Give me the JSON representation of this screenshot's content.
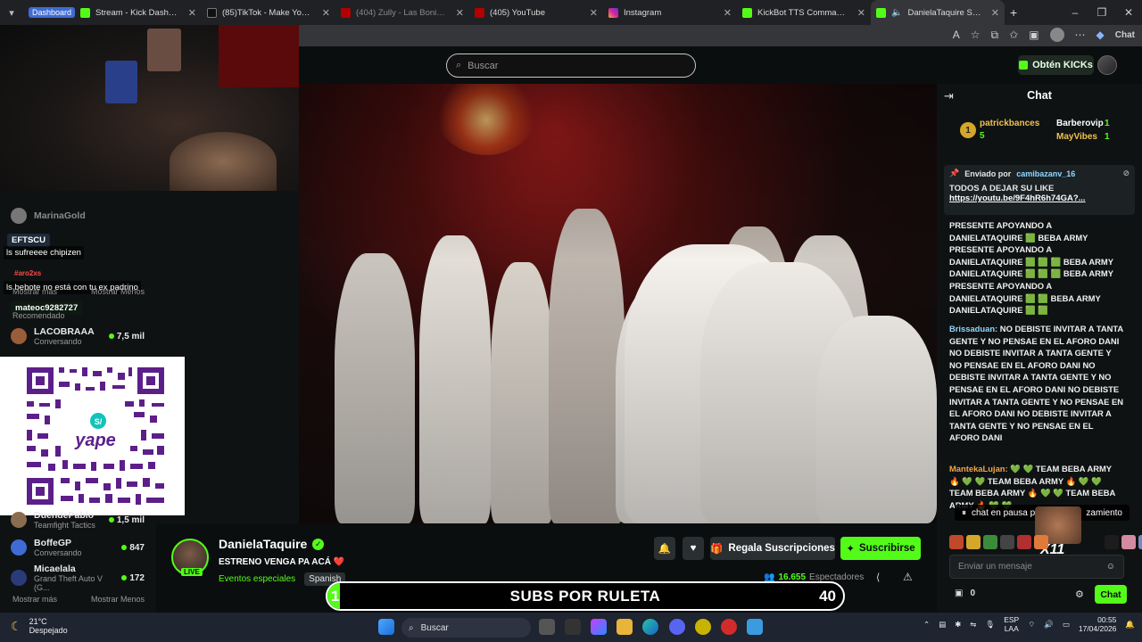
{
  "browser": {
    "tabs": [
      {
        "label": "Stream - Kick Dashboard",
        "badge": "Dashboard",
        "color": "#53fc18"
      },
      {
        "label": "(85)TikTok - Make Your Day",
        "color": "#111111"
      },
      {
        "label": "(404) Zully - Las Bonitas con La",
        "color": "#ff0000"
      },
      {
        "label": "(405) YouTube",
        "color": "#ff0000"
      },
      {
        "label": "Instagram",
        "color": "#d6249f"
      },
      {
        "label": "KickBot TTS Commands",
        "color": "#53fc18"
      },
      {
        "label": "DanielaTaquire Stream - W",
        "color": "#53fc18"
      }
    ],
    "new_tab": "+",
    "chat_button": "Chat"
  },
  "header": {
    "search_placeholder": "Buscar",
    "get_kicks": "Obtén KICKs"
  },
  "sidebar": {
    "items_top": [
      {
        "name": "MarinaGold"
      },
      {
        "name": "LACOBRAAA",
        "sub": "Conversando",
        "count": "7,5 mil"
      }
    ],
    "items_bottom": [
      {
        "name": "DuendePablo",
        "sub": "Teamfight Tactics",
        "count": "1,5 mil"
      },
      {
        "name": "BoffeGP",
        "sub": "Conversando",
        "count": "847"
      },
      {
        "name": "Micaelala",
        "sub": "Grand Theft Auto V (G...",
        "count": "172"
      }
    ],
    "show_more": "Mostrar más",
    "show_less": "Mostrar Menos",
    "recommended": "Recomendado",
    "overlay_messages": {
      "tag1": "EFTSCU",
      "msg1": "ls sufreeee chipizen",
      "mention": "#aro2xs",
      "msg2": "ls bebote no está con tu ex padrino",
      "tag2": "mateoc9282727"
    },
    "qr_label": "yape"
  },
  "chat": {
    "title": "Chat",
    "leaderboard": [
      {
        "rank": "1",
        "name": "patrickbances",
        "count": "5"
      },
      {
        "name": "Barberovip",
        "count": "1"
      },
      {
        "name": "MayVibes",
        "count": "1"
      }
    ],
    "pinned": {
      "sent_by": "Enviado por",
      "user": "camibazanv_16",
      "text": "TODOS A DEJAR SU LIKE",
      "link": "https://youtu.be/9F4hR6h74GA?..."
    },
    "messages": [
      {
        "user": "",
        "text": "PRESENTE APOYANDO A DANIELATAQUIRE 🟩 BEBA ARMY PRESENTE APOYANDO A DANIELATAQUIRE 🟩 🟩 🟩 BEBA ARMY DANIELATAQUIRE 🟩 🟩 🟩 BEBA ARMY PRESENTE APOYANDO A DANIELATAQUIRE 🟩 🟩 BEBA ARMY DANIELATAQUIRE 🟩 🟩"
      },
      {
        "user": "Brissaduan:",
        "text": "NO DEBISTE INVITAR A TANTA GENTE Y NO PENSAE EN EL AFORO DANI NO DEBISTE INVITAR A TANTA GENTE Y NO PENSAE EN EL AFORO DANI NO DEBISTE INVITAR A TANTA GENTE Y NO PENSAE EN EL AFORO DANI NO DEBISTE INVITAR A TANTA GENTE Y NO PENSAE EN EL AFORO DANI NO DEBISTE INVITAR A TANTA GENTE Y NO PENSAE EN EL AFORO DANI"
      },
      {
        "user": "MantekaLujan:",
        "text": "💚 💚 TEAM BEBA ARMY 🔥 💚 💚 TEAM BEBA ARMY 🔥 💚 💚 TEAM BEBA ARMY 🔥 💚 💚 TEAM BEBA ARMY 🔥 💚 💚"
      }
    ],
    "paused": "chat en pausa p",
    "paused_tail": "zamiento",
    "input_placeholder": "Enviar un mensaje",
    "points": "0",
    "send": "Chat",
    "combo": "X11"
  },
  "stream": {
    "name": "DanielaTaquire",
    "live_badge": "LIVE",
    "title": "ESTRENO VENGA PA ACÁ ❤️",
    "category": "Eventos especiales",
    "language": "Spanish",
    "gift_subs": "Regala Suscripciones",
    "subscribe": "Suscribirse",
    "viewers": "16.655",
    "viewers_label": "Espectadores"
  },
  "roulette": {
    "label": "SUBS POR RULETA",
    "start": "1",
    "count": "40",
    "progress": 0.025
  },
  "taskbar": {
    "temp": "21°C",
    "weather": "Despejado",
    "search": "Buscar",
    "lang": "ESP",
    "lang2": "LAA",
    "time": "00:55",
    "date": "17/04/2026"
  },
  "colors": {
    "accent": "#53fc18",
    "background": "#0b0e0f"
  }
}
